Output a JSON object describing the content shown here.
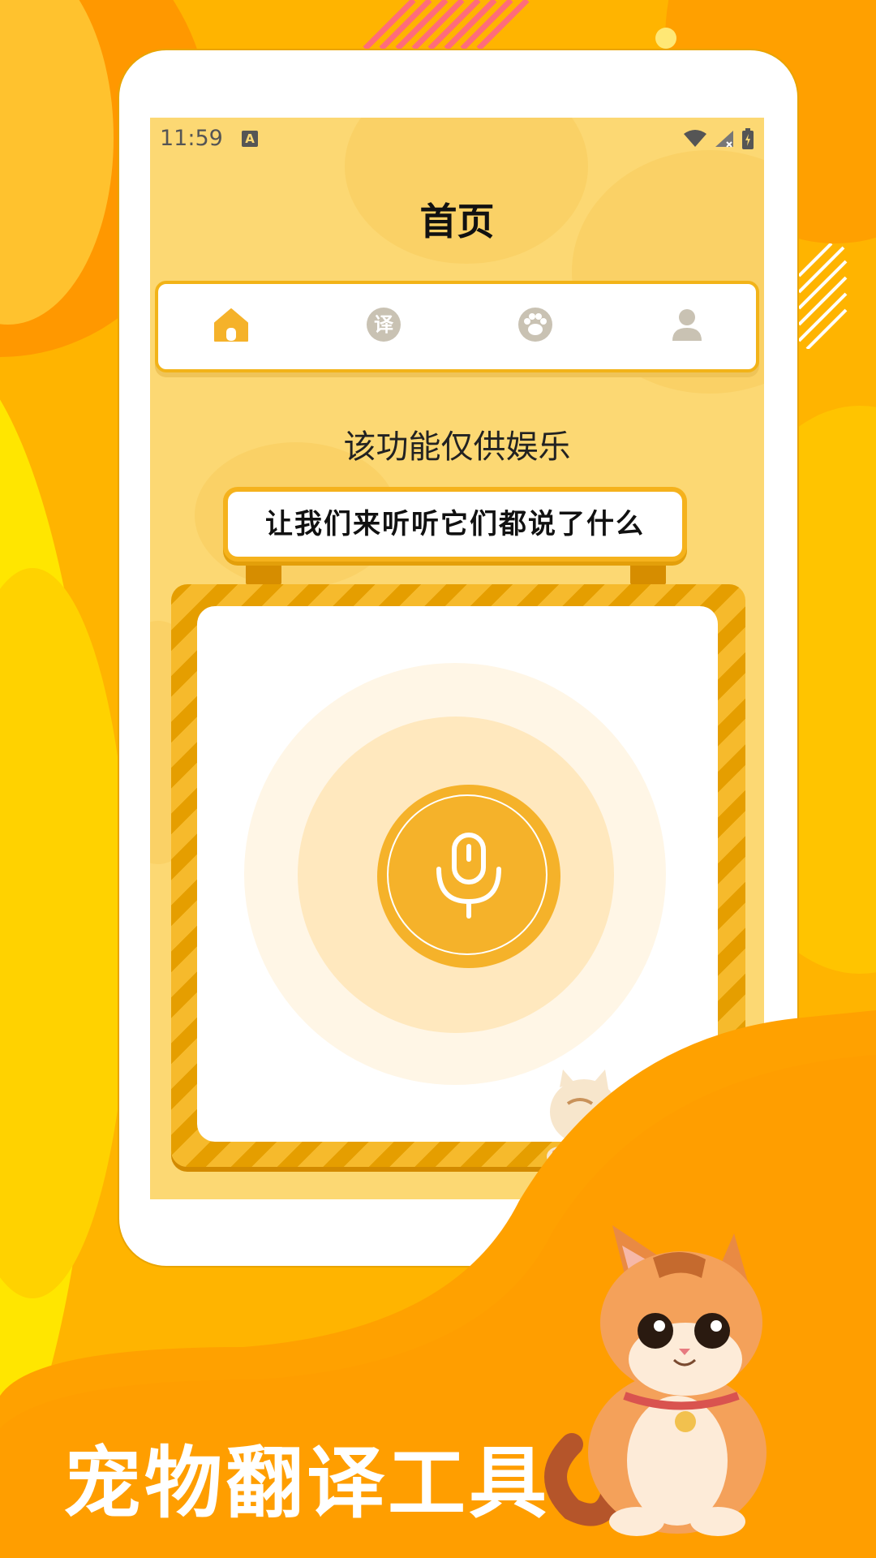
{
  "status_bar": {
    "time": "11:59",
    "notification_glyph": "A"
  },
  "header": {
    "title": "首页"
  },
  "tabs": [
    {
      "name": "home",
      "icon": "home-icon",
      "active": true
    },
    {
      "name": "translate",
      "icon": "translate-icon",
      "glyph": "译",
      "active": false
    },
    {
      "name": "pet",
      "icon": "paw-icon",
      "active": false
    },
    {
      "name": "profile",
      "icon": "person-icon",
      "active": false
    }
  ],
  "notice": "该功能仅供娱乐",
  "sign": {
    "text": "让我们来听听它们都说了什么"
  },
  "record": {
    "icon": "microphone-icon"
  },
  "promo": {
    "title": "宠物翻译工具"
  },
  "colors": {
    "accent": "#F5B22A",
    "background": "#FFB400",
    "screen": "#FCD873",
    "tab_inactive": "#C9C2B3"
  }
}
